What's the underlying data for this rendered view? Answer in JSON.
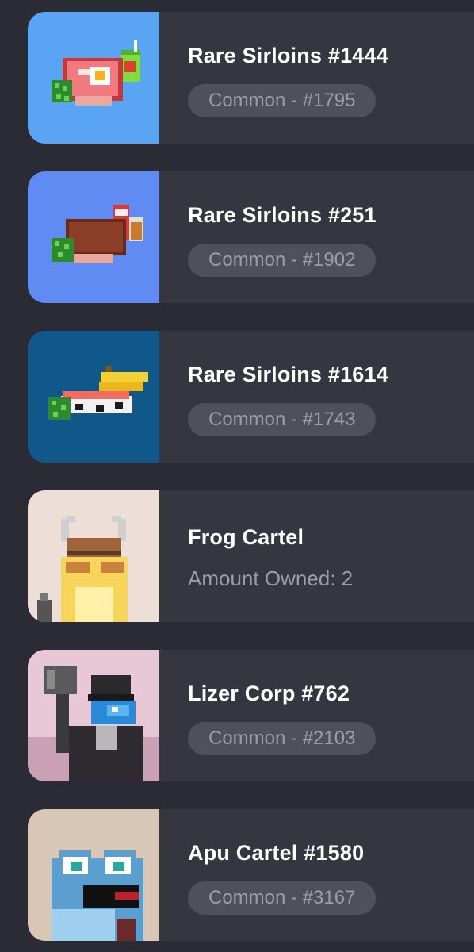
{
  "items": [
    {
      "title": "Rare Sirloins #1444",
      "badge": "Common - #1795",
      "thumb_bg": "#5aa5f3",
      "thumb": "steak-with-egg-and-juice-box"
    },
    {
      "title": "Rare Sirloins #251",
      "badge": "Common - #1902",
      "thumb_bg": "#5f8bf2",
      "thumb": "steak-with-soda-can-and-glass"
    },
    {
      "title": "Rare Sirloins #1614",
      "badge": "Common - #1743",
      "thumb_bg": "#10578a",
      "thumb": "sushi-with-bananas"
    },
    {
      "title": "Frog Cartel",
      "amount": "Amount Owned: 2",
      "thumb_bg": "#eeded8",
      "thumb": "yellow-frog-viking-helmet"
    },
    {
      "title": "Lizer Corp #762",
      "badge": "Common - #2103",
      "thumb_bg": "#e8c8d6",
      "thumb": "blue-lizard-with-axe"
    },
    {
      "title": "Apu Cartel #1580",
      "badge": "Common - #3167",
      "thumb_bg": "#d8c7b4",
      "thumb": "blue-frog-apu"
    }
  ]
}
